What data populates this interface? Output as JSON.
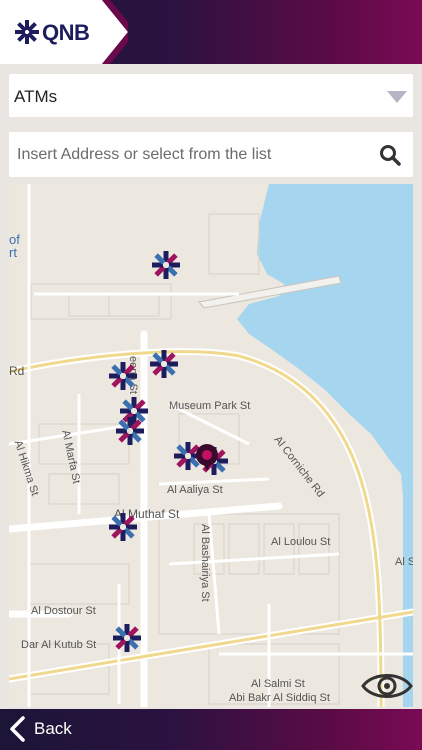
{
  "header": {
    "logo_text": "QNB"
  },
  "filter": {
    "selected": "ATMs"
  },
  "search": {
    "placeholder": "Insert Address or select from the list"
  },
  "map": {
    "labels": {
      "fort_partial_1": "of",
      "fort_partial_2": "rt",
      "rd_partial": "Rd",
      "museum_park": "Museum Park St",
      "corniche": "Al Corniche Rd",
      "al_hikma": "Al Hikma St",
      "al_marfa": "Al Marfa St",
      "al_aaliya": "Al Aaliya St",
      "al_muthaf": "Al Muthaf St",
      "al_bashairiya": "Al Bashairiya St",
      "al_loulou": "Al Loulou St",
      "al_dostour": "Al Dostour St",
      "dar_al_kutub": "Dar Al Kutub St",
      "al_salmi": "Al Salmi St",
      "abi_bakr": "Abi Bakr Al Siddiq St",
      "al_s_partial": "Al S",
      "meena_partial": "eena St"
    }
  },
  "footer": {
    "back_label": "Back"
  },
  "colors": {
    "brand_dark": "#1b1537",
    "brand_magenta": "#7b0a55",
    "water": "#a6d6ef"
  }
}
